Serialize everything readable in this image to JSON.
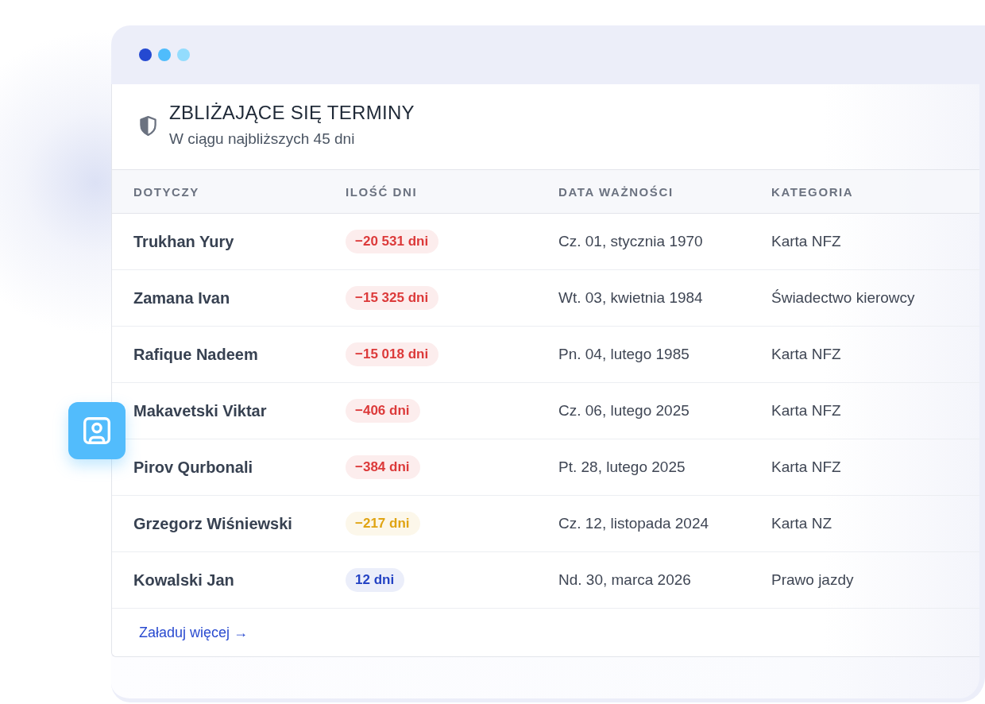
{
  "panel": {
    "title": "ZBLIŻAJĄCE SIĘ TERMINY",
    "subtitle": "W ciągu najbliższych 45 dni"
  },
  "table": {
    "columns": [
      "DOTYCZY",
      "ILOŚĆ DNI",
      "DATA WAŻNOŚCI",
      "KATEGORIA"
    ],
    "rows": [
      {
        "name": "Trukhan Yury",
        "days": "−20 531 dni",
        "color": "#dc3a3a",
        "date": "Cz. 01, stycznia 1970",
        "category": "Karta NFZ"
      },
      {
        "name": "Zamana Ivan",
        "days": "−15 325 dni",
        "color": "#dc3a3a",
        "date": "Wt. 03, kwietnia 1984",
        "category": "Świadectwo kierowcy"
      },
      {
        "name": "Rafique Nadeem",
        "days": "−15 018 dni",
        "color": "#dc3a3a",
        "date": "Pn. 04, lutego 1985",
        "category": "Karta NFZ"
      },
      {
        "name": "Makavetski Viktar",
        "days": "−406 dni",
        "color": "#dc3a3a",
        "date": "Cz. 06, lutego 2025",
        "category": "Karta NFZ"
      },
      {
        "name": "Pirov Qurbonali",
        "days": "−384 dni",
        "color": "#dc3a3a",
        "date": "Pt. 28, lutego 2025",
        "category": "Karta NFZ"
      },
      {
        "name": "Grzegorz Wiśniewski",
        "days": "−217 dni",
        "color": "#e0a412",
        "date": "Cz. 12, listopada 2024",
        "category": "Karta NZ"
      },
      {
        "name": "Kowalski Jan",
        "days": "12 dni",
        "color": "#2443c4",
        "date": "Nd. 30, marca 2026",
        "category": "Prawo jazdy"
      }
    ]
  },
  "footer": {
    "link": "Załaduj więcej →"
  }
}
